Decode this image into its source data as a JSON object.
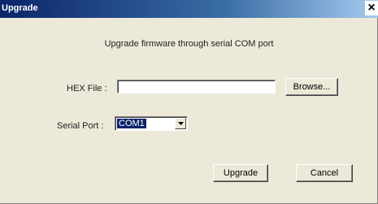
{
  "window": {
    "title": "Upgrade",
    "close_glyph": "×"
  },
  "heading": "Upgrade firmware through serial COM port",
  "hex_file": {
    "label": "HEX File :",
    "value": "",
    "browse_label": "Browse..."
  },
  "serial_port": {
    "label": "Serial Port :",
    "selected": "COM1"
  },
  "actions": {
    "upgrade_label": "Upgrade",
    "cancel_label": "Cancel"
  },
  "icons": {
    "close": "close-icon",
    "dropdown": "chevron-down-icon"
  },
  "colors": {
    "titlebar_start": "#0a246a",
    "titlebar_end": "#a6caf0",
    "dialog_bg": "#ece9d8",
    "selection_bg": "#0a246a"
  }
}
